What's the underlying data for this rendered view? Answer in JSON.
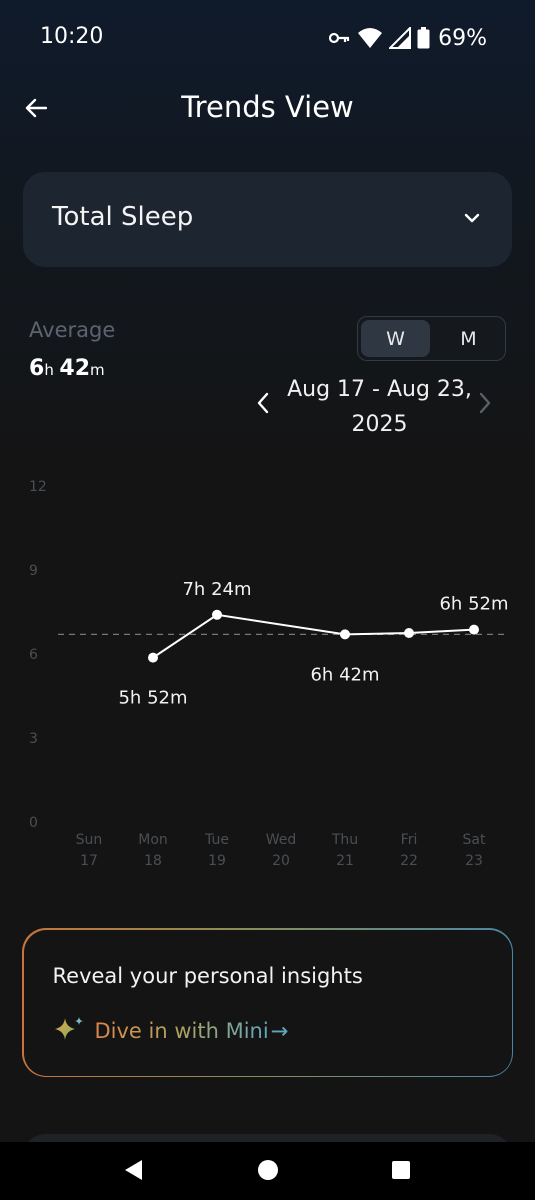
{
  "status_bar": {
    "time": "10:20",
    "battery": "69%",
    "icons": [
      "vpn-key-icon",
      "wifi-icon",
      "signal-icon",
      "battery-icon"
    ]
  },
  "app_bar": {
    "title": "Trends View",
    "back_icon": "arrow-left-icon"
  },
  "metric_selector": {
    "value": "Total Sleep",
    "icon": "chevron-down-icon"
  },
  "average": {
    "label": "Average",
    "hours": "6",
    "hours_unit": "h",
    "minutes": "42",
    "minutes_unit": "m"
  },
  "period_toggle": {
    "options": [
      "W",
      "M"
    ],
    "selected": "W"
  },
  "date_range": {
    "line1": "Aug 17 - Aug 23,",
    "line2": "2025"
  },
  "chart_data": {
    "type": "line",
    "x": [
      "Sun 17",
      "Mon 18",
      "Tue 19",
      "Wed 20",
      "Thu 21",
      "Fri 22",
      "Sat 23"
    ],
    "day_names": [
      "Sun",
      "Mon",
      "Tue",
      "Wed",
      "Thu",
      "Fri",
      "Sat"
    ],
    "day_numbers": [
      "17",
      "18",
      "19",
      "20",
      "21",
      "22",
      "23"
    ],
    "ylim": [
      0,
      12
    ],
    "yticks": [
      "0",
      "3",
      "6",
      "9",
      "12"
    ],
    "series": [
      {
        "values": [
          null,
          5.87,
          7.4,
          null,
          6.7,
          6.75,
          6.87
        ],
        "labels": [
          "",
          "5h 52m",
          "7h 24m",
          "",
          "6h 42m",
          "",
          "6h 52m"
        ]
      }
    ],
    "average_line": 6.7,
    "colors": {
      "line": "#ffffff",
      "average": "#777777",
      "axis_text": "#4a4f55"
    }
  },
  "insight_card": {
    "title": "Reveal your personal insights",
    "link_text": "Dive in with Mini",
    "link_arrow": "→",
    "icon": "sparkle-icon",
    "gradient": [
      "#c8743c",
      "#8a8f58",
      "#4a87a6"
    ]
  },
  "nav_bar": {
    "buttons": [
      "back-triangle-icon",
      "home-circle-icon",
      "recents-square-icon"
    ]
  }
}
